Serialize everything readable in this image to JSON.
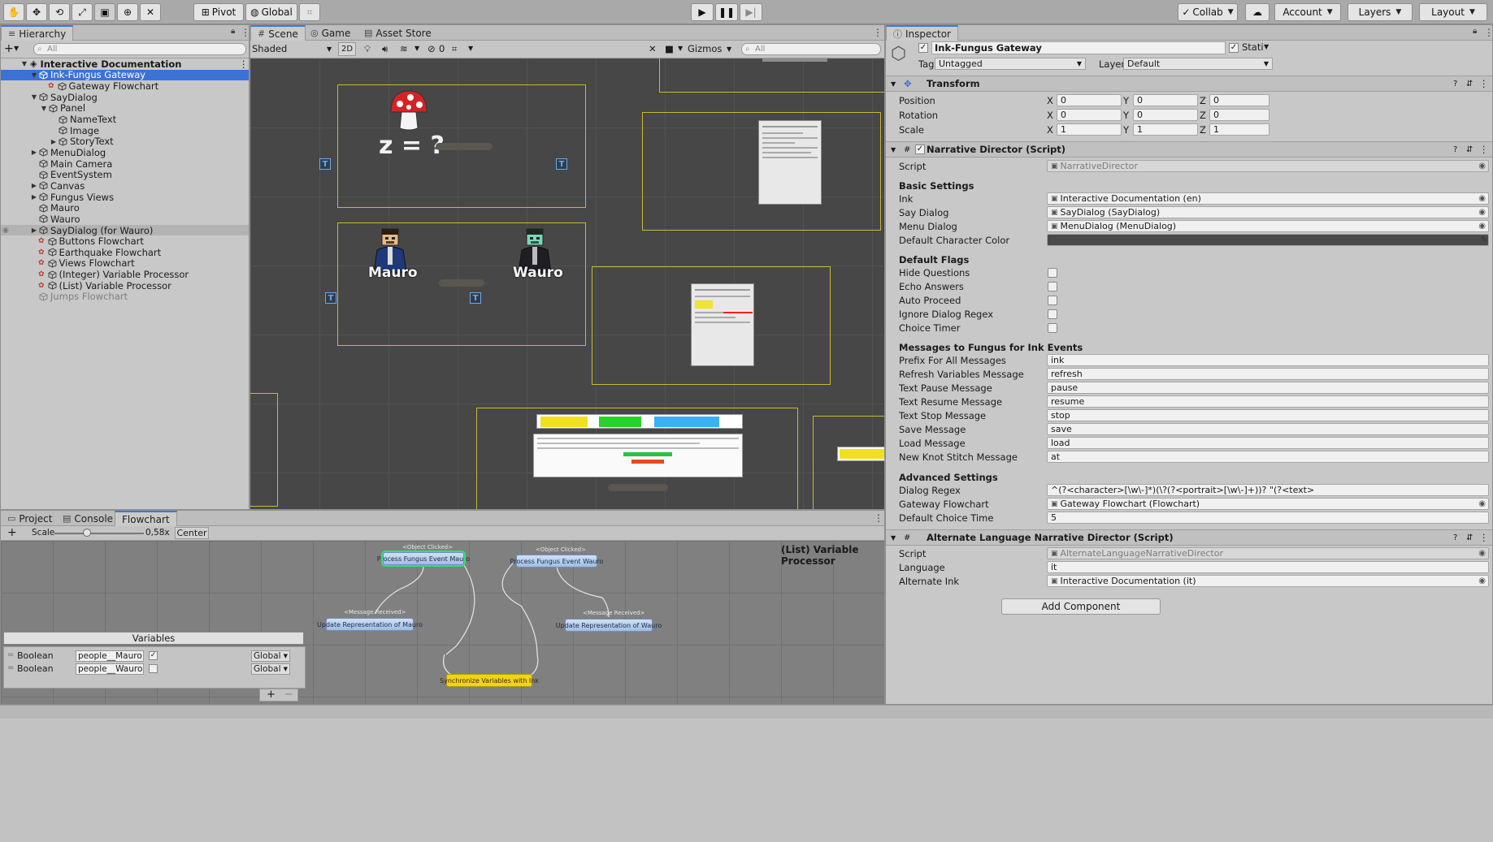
{
  "toolbar": {
    "pivot": "Pivot",
    "global": "Global",
    "collab": "Collab",
    "account": "Account",
    "layers": "Layers",
    "layout": "Layout"
  },
  "hierarchy": {
    "tab": "Hierarchy",
    "search_placeholder": "All",
    "scene_name": "Interactive Documentation",
    "items": [
      {
        "label": "Ink-Fungus Gateway",
        "depth": 1,
        "arrow": "down",
        "selected": true
      },
      {
        "label": "Gateway Flowchart",
        "depth": 2,
        "arrow": "",
        "fungus": true
      },
      {
        "label": "SayDialog",
        "depth": 1,
        "arrow": "down"
      },
      {
        "label": "Panel",
        "depth": 2,
        "arrow": "down"
      },
      {
        "label": "NameText",
        "depth": 3,
        "arrow": ""
      },
      {
        "label": "Image",
        "depth": 3,
        "arrow": ""
      },
      {
        "label": "StoryText",
        "depth": 3,
        "arrow": "right"
      },
      {
        "label": "MenuDialog",
        "depth": 1,
        "arrow": "right"
      },
      {
        "label": "Main Camera",
        "depth": 1,
        "arrow": ""
      },
      {
        "label": "EventSystem",
        "depth": 1,
        "arrow": ""
      },
      {
        "label": "Canvas",
        "depth": 1,
        "arrow": "right"
      },
      {
        "label": "Fungus Views",
        "depth": 1,
        "arrow": "right"
      },
      {
        "label": "Mauro",
        "depth": 1,
        "arrow": ""
      },
      {
        "label": "Wauro",
        "depth": 1,
        "arrow": ""
      },
      {
        "label": "SayDialog (for Wauro)",
        "depth": 1,
        "arrow": "right",
        "hover": true
      },
      {
        "label": "Buttons Flowchart",
        "depth": 1,
        "arrow": "",
        "fungus": true
      },
      {
        "label": "Earthquake Flowchart",
        "depth": 1,
        "arrow": "",
        "fungus": true
      },
      {
        "label": "Views Flowchart",
        "depth": 1,
        "arrow": "",
        "fungus": true
      },
      {
        "label": "(Integer) Variable Processor",
        "depth": 1,
        "arrow": "",
        "fungus": true
      },
      {
        "label": "(List) Variable Processor",
        "depth": 1,
        "arrow": "",
        "fungus": true
      },
      {
        "label": "Jumps Flowchart",
        "depth": 1,
        "arrow": "",
        "dim": true
      }
    ]
  },
  "scene": {
    "tabs": [
      "Scene",
      "Game",
      "Asset Store"
    ],
    "shading": "Shaded",
    "mode_2d": "2D",
    "fx_count": "0",
    "gizmos": "Gizmos",
    "search_placeholder": "All",
    "equation": "z = ?",
    "char1": "Mauro",
    "char2": "Wauro"
  },
  "bottom": {
    "tabs": [
      "Project",
      "Console",
      "Flowchart"
    ],
    "scale_label": "Scale",
    "scale_value": "0,58x",
    "scale_fraction": 0.4,
    "center": "Center",
    "flowchart_name": "(List) Variable Processor",
    "nodes": {
      "n1": {
        "event": "<Object Clicked>",
        "label": "Process Fungus Event Mauro"
      },
      "n2": {
        "event": "<Object Clicked>",
        "label": "Process Fungus Event Wauro"
      },
      "n3": {
        "event": "<Message Received>",
        "label": "Update Representation of Mauro"
      },
      "n4": {
        "event": "<Message Received>",
        "label": "Update Representation of Wauro"
      },
      "n5": {
        "event": "",
        "label": "Synchronize Variables with Ink"
      }
    },
    "variables_title": "Variables",
    "variables": [
      {
        "type": "Boolean",
        "name": "people__Mauro",
        "checked": true,
        "scope": "Global"
      },
      {
        "type": "Boolean",
        "name": "people__Wauro",
        "checked": false,
        "scope": "Global"
      }
    ]
  },
  "inspector": {
    "tab": "Inspector",
    "object_name": "Ink-Fungus Gateway",
    "static": "Stati",
    "tag_label": "Tag",
    "tag_value": "Untagged",
    "layer_label": "Layer",
    "layer_value": "Default",
    "transform": {
      "title": "Transform",
      "position_label": "Position",
      "position": [
        "0",
        "0",
        "0"
      ],
      "rotation_label": "Rotation",
      "rotation": [
        "0",
        "0",
        "0"
      ],
      "scale_label": "Scale",
      "scale": [
        "1",
        "1",
        "1"
      ]
    },
    "narrative": {
      "title": "Narrative Director (Script)",
      "script_label": "Script",
      "script_value": "NarrativeDirector",
      "basic": "Basic Settings",
      "ink_label": "Ink",
      "ink_value": "Interactive Documentation (en)",
      "say_label": "Say Dialog",
      "say_value": "SayDialog (SayDialog)",
      "menu_label": "Menu Dialog",
      "menu_value": "MenuDialog (MenuDialog)",
      "color_label": "Default Character Color",
      "default_character_color": "#4a4a4a",
      "flags": "Default Flags",
      "flag_items": [
        "Hide Questions",
        "Echo Answers",
        "Auto Proceed",
        "Ignore Dialog Regex",
        "Choice Timer"
      ],
      "messages": "Messages to Fungus for Ink Events",
      "msg_items": [
        {
          "label": "Prefix For All Messages",
          "value": "ink"
        },
        {
          "label": "Refresh Variables Message",
          "value": "refresh"
        },
        {
          "label": "Text Pause Message",
          "value": "pause"
        },
        {
          "label": "Text Resume Message",
          "value": "resume"
        },
        {
          "label": "Text Stop Message",
          "value": "stop"
        },
        {
          "label": "Save Message",
          "value": "save"
        },
        {
          "label": "Load Message",
          "value": "load"
        },
        {
          "label": "New Knot Stitch Message",
          "value": "at"
        }
      ],
      "advanced": "Advanced Settings",
      "regex_label": "Dialog Regex",
      "regex_value": "^(?<character>[\\w\\-]*)(\\?(?<portrait>[\\w\\-]+))? \"(?<text>",
      "gateway_label": "Gateway Flowchart",
      "gateway_value": "Gateway Flowchart (Flowchart)",
      "choice_label": "Default Choice Time",
      "choice_value": "5"
    },
    "alternate": {
      "title": "Alternate Language Narrative Director (Script)",
      "script_label": "Script",
      "script_value": "AlternateLanguageNarrativeDirector",
      "lang_label": "Language",
      "lang_value": "it",
      "ink_label": "Alternate Ink",
      "ink_value": "Interactive Documentation (it)"
    },
    "add_component": "Add Component"
  }
}
